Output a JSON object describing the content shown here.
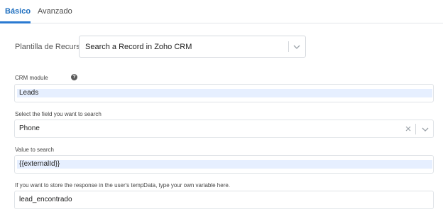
{
  "tabs": [
    {
      "label": "Básico",
      "active": true
    },
    {
      "label": "Avanzado",
      "active": false
    }
  ],
  "resource_template": {
    "label": "Plantilla de Recurso",
    "selected": "Search a Record in Zoho CRM"
  },
  "fields": {
    "crm_module": {
      "label": "CRM module",
      "value": "Leads",
      "help_icon": "question-circle-icon"
    },
    "search_field": {
      "label": "Select the field you want to search",
      "selected": "Phone"
    },
    "search_value": {
      "label": "Value to search",
      "value": "{{externalId}}"
    },
    "temp_variable": {
      "label": "If you want to store the response in the user's tempData, type your own variable here.",
      "value": "lead_encontrado"
    }
  },
  "colors": {
    "accent": "#2a7ad1",
    "highlight": "#e6efff",
    "border": "#dfe3e7"
  }
}
